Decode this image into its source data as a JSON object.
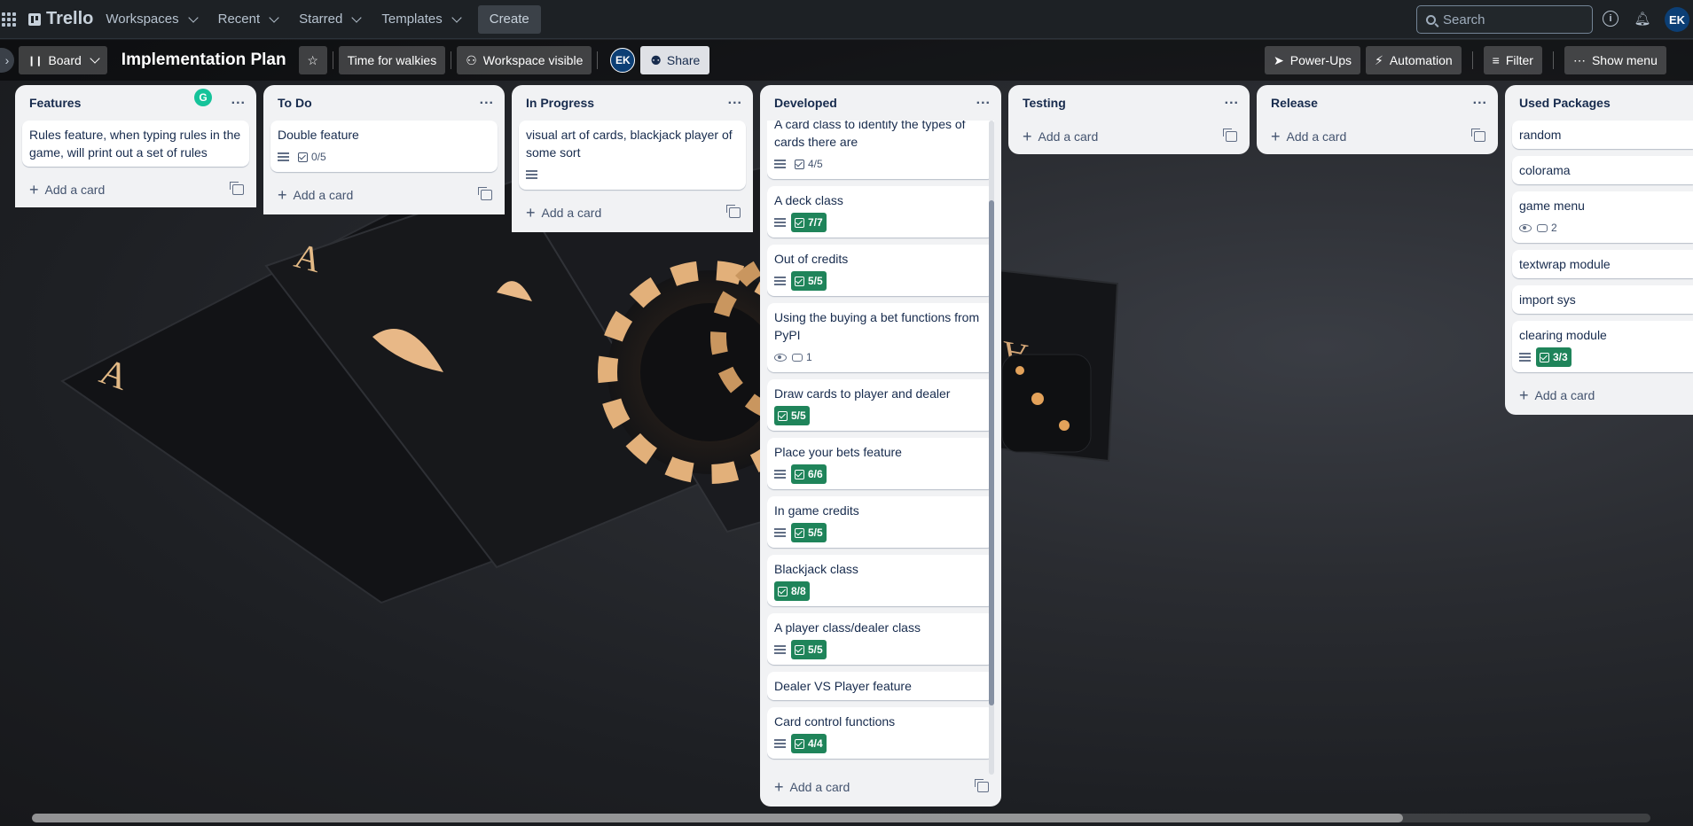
{
  "nav": {
    "logo": "Trello",
    "menus": [
      {
        "label": "Workspaces"
      },
      {
        "label": "Recent"
      },
      {
        "label": "Starred"
      },
      {
        "label": "Templates"
      }
    ],
    "create": "Create",
    "search_placeholder": "Search",
    "user_initials": "EK"
  },
  "board": {
    "view": "Board",
    "title": "Implementation Plan",
    "custom_btn": "Time for walkies",
    "visibility": "Workspace visible",
    "member_initials": "EK",
    "share": "Share",
    "powerups": "Power-Ups",
    "automation": "Automation",
    "filter": "Filter",
    "show_menu": "Show menu"
  },
  "add_card": "Add a card",
  "lists": [
    {
      "title": "Features",
      "cards": [
        {
          "text": "Rules feature, when typing rules in the game, will print out a set of rules"
        }
      ]
    },
    {
      "title": "To Do",
      "cards": [
        {
          "text": "Double feature",
          "checklist": "0/5"
        }
      ]
    },
    {
      "title": "In Progress",
      "cards": [
        {
          "text": "visual art of cards, blackjack player of some sort"
        }
      ]
    },
    {
      "title": "Developed",
      "cards": [
        {
          "text": "A card class to identify the types of cards there are",
          "checklist": "4/5"
        },
        {
          "text": "A deck class",
          "checklist": "7/7"
        },
        {
          "text": "Out of credits",
          "checklist": "5/5"
        },
        {
          "text": "Using the buying a bet functions from PyPI",
          "comments": "1"
        },
        {
          "text": "Draw cards to player and dealer",
          "checklist": "5/5"
        },
        {
          "text": "Place your bets feature",
          "checklist": "6/6"
        },
        {
          "text": "In game credits",
          "checklist": "5/5"
        },
        {
          "text": "Blackjack class",
          "checklist": "8/8"
        },
        {
          "text": "A player class/dealer class",
          "checklist": "5/5"
        },
        {
          "text": "Dealer VS Player feature"
        },
        {
          "text": "Card control functions",
          "checklist": "4/4"
        }
      ]
    },
    {
      "title": "Testing",
      "cards": []
    },
    {
      "title": "Release",
      "cards": []
    },
    {
      "title": "Used Packages",
      "cards": [
        {
          "text": "random"
        },
        {
          "text": "colorama"
        },
        {
          "text": "game menu",
          "comments": "2"
        },
        {
          "text": "textwrap module"
        },
        {
          "text": "import sys"
        },
        {
          "text": "clearing module",
          "checklist": "3/3"
        }
      ]
    }
  ],
  "colors": {
    "checklist_done": "#1f845a",
    "list_bg": "#f1f2f4",
    "nav_bg": "#1d2125"
  }
}
